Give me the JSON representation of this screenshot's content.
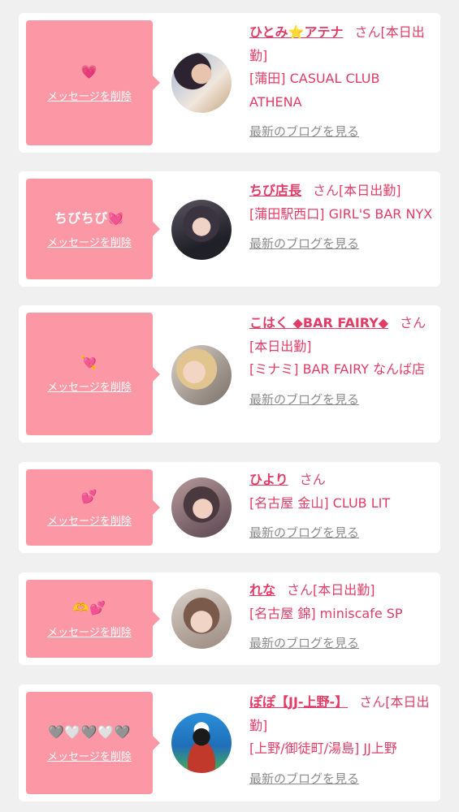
{
  "colors": {
    "page_bg": "#f0f0f0",
    "bubble": "#fc97a5",
    "accent_text": "#e23c66",
    "link_gray": "#8c8c8c"
  },
  "delete_label": "メッセージを削除",
  "blog_label": "最新のブログを見る",
  "san": "さん",
  "cards": [
    {
      "message": "💗",
      "name": "ひとみ⭐アテナ",
      "status": "[本日出勤]",
      "shop": "[蒲田] CASUAL CLUB ATHENA",
      "avatar": "avatar-photo"
    },
    {
      "message": "ちびちび💓",
      "name": "ちび店長",
      "status": "[本日出勤]",
      "shop": "[蒲田駅西口] GIRL'S BAR NYX",
      "avatar": "avatar-photo"
    },
    {
      "message": "💘",
      "name": "こはく ◆BAR FAIRY◆",
      "status": "[本日出勤]",
      "shop": "[ミナミ] BAR FAIRY なんば店",
      "avatar": "avatar-photo"
    },
    {
      "message": "💕",
      "name": "ひより",
      "status": "",
      "shop": "[名古屋 金山] CLUB LIT",
      "avatar": "avatar-photo"
    },
    {
      "message": "🫶💕",
      "name": "れな",
      "status": "[本日出勤]",
      "shop": "[名古屋 錦] miniscafe SP",
      "avatar": "avatar-photo"
    },
    {
      "message": "🩶🤍🩶🤍🩶",
      "name": "ぽぽ【JJ-上野-】",
      "status": "[本日出勤]",
      "shop": "[上野/御徒町/湯島] JJ上野",
      "avatar": "avatar-character-illustration"
    }
  ]
}
